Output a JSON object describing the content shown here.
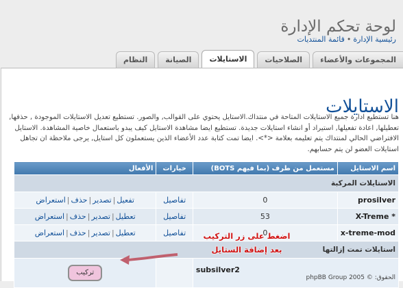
{
  "header": {
    "site_title": "لوحة تحكم الإدارة",
    "breadcrumb": [
      "رئيسية الإدارة",
      "قائمة المنتديات"
    ],
    "breadcrumb_sep": "•"
  },
  "tabs": [
    {
      "label": "المجموعات والأعضاء",
      "active": false
    },
    {
      "label": "الصلاحيات",
      "active": false
    },
    {
      "label": "الاستايلات",
      "active": true
    },
    {
      "label": "الصيانة",
      "active": false
    },
    {
      "label": "النظام",
      "active": false
    }
  ],
  "main": {
    "heading": "الاستايلات",
    "intro": "هنا تستطيع ادارة جميع الاستايلات المتاحة في منتداك.الاستايل يحتوي على القوالب, والصور. تستطيع تعديل الاستايلات الموجودة , حذفها, تعطيلها, اعادة تفعيلها, استيراد أو انشاء استايلات جديدة. تستطيع ايضا مشاهدة الاستايل كيف يبدو باستعمال خاصية المشاهدة. الاستايل الافتراضي الحالي لمنتداك يتم تعليمه بعلامة <*>. ايضا تمت كتابة عدد الأعضاء الذين يستعملون كل استايل, يرجى ملاحظة ان تجاهل استايلات العضو لن يتم حسابهم."
  },
  "table": {
    "headers": {
      "name": "اسم الاستايل",
      "users": "مستعمل من طرف (بما فيهم BOTS)",
      "options": "خيارات",
      "actions": "الأفعال"
    },
    "installed_group": "الاستايلات المركبة",
    "rows": [
      {
        "name": "prosilver",
        "users": "0",
        "details": "تفاصيل",
        "actions": [
          "تفعيل",
          "تصدير",
          "حذف",
          "استعراض"
        ]
      },
      {
        "name": "X-Treme *",
        "users": "53",
        "details": "تفاصيل",
        "actions": [
          "تعطيل",
          "تصدير",
          "حذف",
          "استعراض"
        ]
      },
      {
        "name": "x-treme-mod",
        "users": "0",
        "details": "تفاصيل",
        "actions": [
          "تعطيل",
          "تصدير",
          "حذف",
          "استعراض"
        ]
      }
    ],
    "uninstalled_group": "استايلات تمت إزالتها",
    "uninstalled": {
      "name": "subsilver2",
      "copyright": "الحقوق: © phpBB Group 2005",
      "install_label": "تركيب"
    }
  },
  "annotation": {
    "line1": "اضغط على زر التركيب",
    "line2": "بعد إضافة الستايل",
    "color": "#d11515"
  },
  "colors": {
    "header_blue": "#4178ad",
    "heading_blue": "#115098",
    "install_button": "#f0c4dd"
  }
}
